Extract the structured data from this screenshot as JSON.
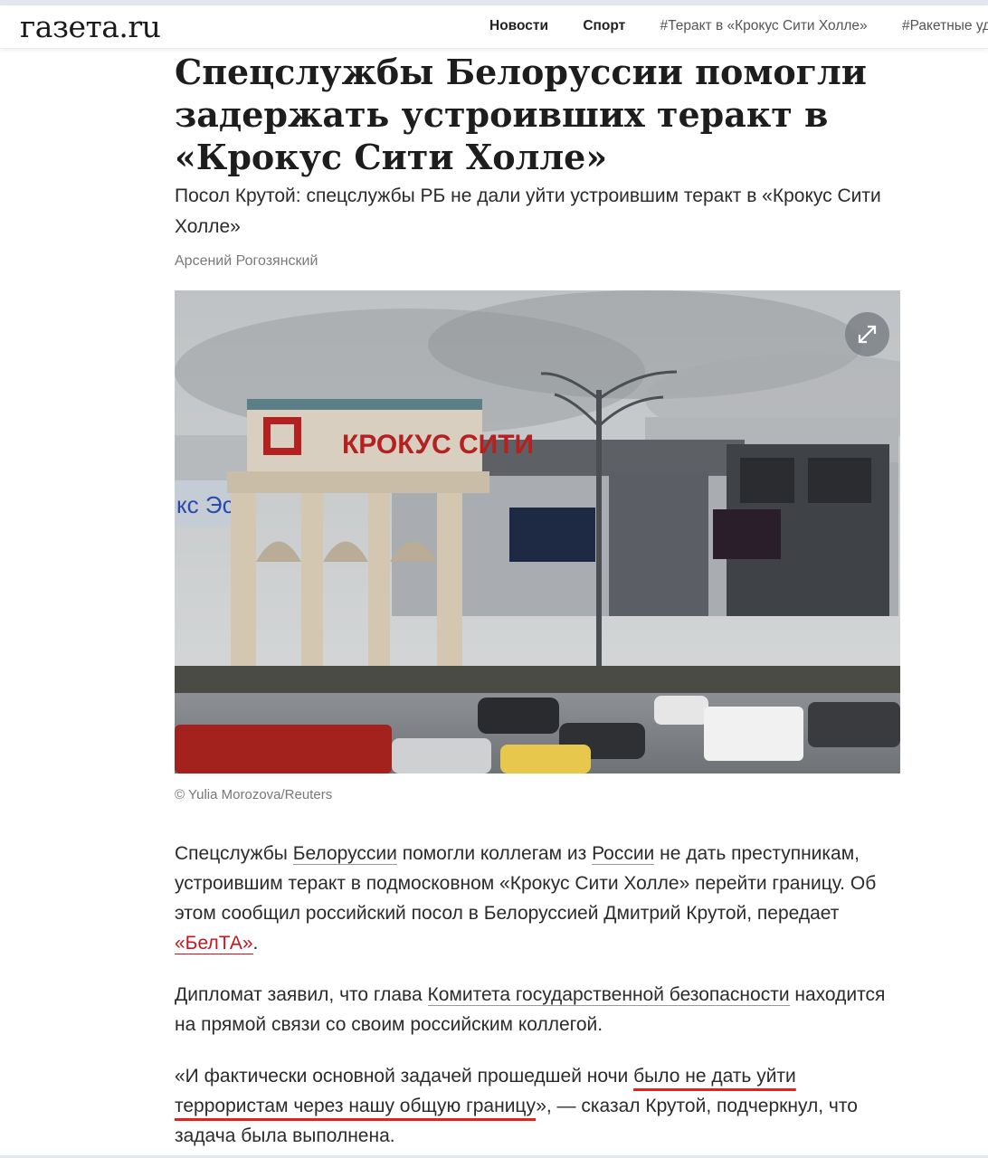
{
  "site": {
    "logo": "газета.ru"
  },
  "nav": {
    "items": [
      "Новости",
      "Спорт",
      "#Теракт в «Крокус Сити Холле»",
      "#Ракетные уд"
    ]
  },
  "article": {
    "title": "Спецслужбы Белоруссии помогли задержать устроивших теракт в «Крокус Сити Холле»",
    "subtitle": "Посол Крутой: спецслужбы РБ не дали уйти устроившим теракт в «Крокус Сити Холле»",
    "author": "Арсений Рогозянский",
    "photo": {
      "sign_text": "КРОКУС СИТИ",
      "credit": "© Yulia Morozova/Reuters"
    },
    "paragraphs": [
      {
        "parts": [
          {
            "text": "Спецслужбы "
          },
          {
            "text": "Белоруссии",
            "link": true
          },
          {
            "text": " помогли коллегам из "
          },
          {
            "text": "России",
            "link": true
          },
          {
            "text": " не дать преступникам, устроившим теракт в подмосковном «Крокус Сити Холле» перейти границу. Об этом сообщил российский посол в Белоруссией Дмитрий Крутой, передает "
          },
          {
            "text": "«БелТА»",
            "link": true,
            "accent": true
          },
          {
            "text": "."
          }
        ]
      },
      {
        "parts": [
          {
            "text": "Дипломат заявил, что глава "
          },
          {
            "text": "Комитета государственной безопасности",
            "link": true
          },
          {
            "text": " находится на прямой связи со своим российским коллегой."
          }
        ]
      },
      {
        "parts": [
          {
            "text": "«И фактически основной задачей прошедшей ночи "
          },
          {
            "text": "было не дать уйти террористам через нашу общую границу",
            "highlight": true
          },
          {
            "text": "», — сказал Крутой, подчеркнул, что задача была выполнена."
          }
        ]
      }
    ]
  },
  "colors": {
    "link_accent": "#c0181f",
    "highlight_underline": "#e5221a"
  }
}
